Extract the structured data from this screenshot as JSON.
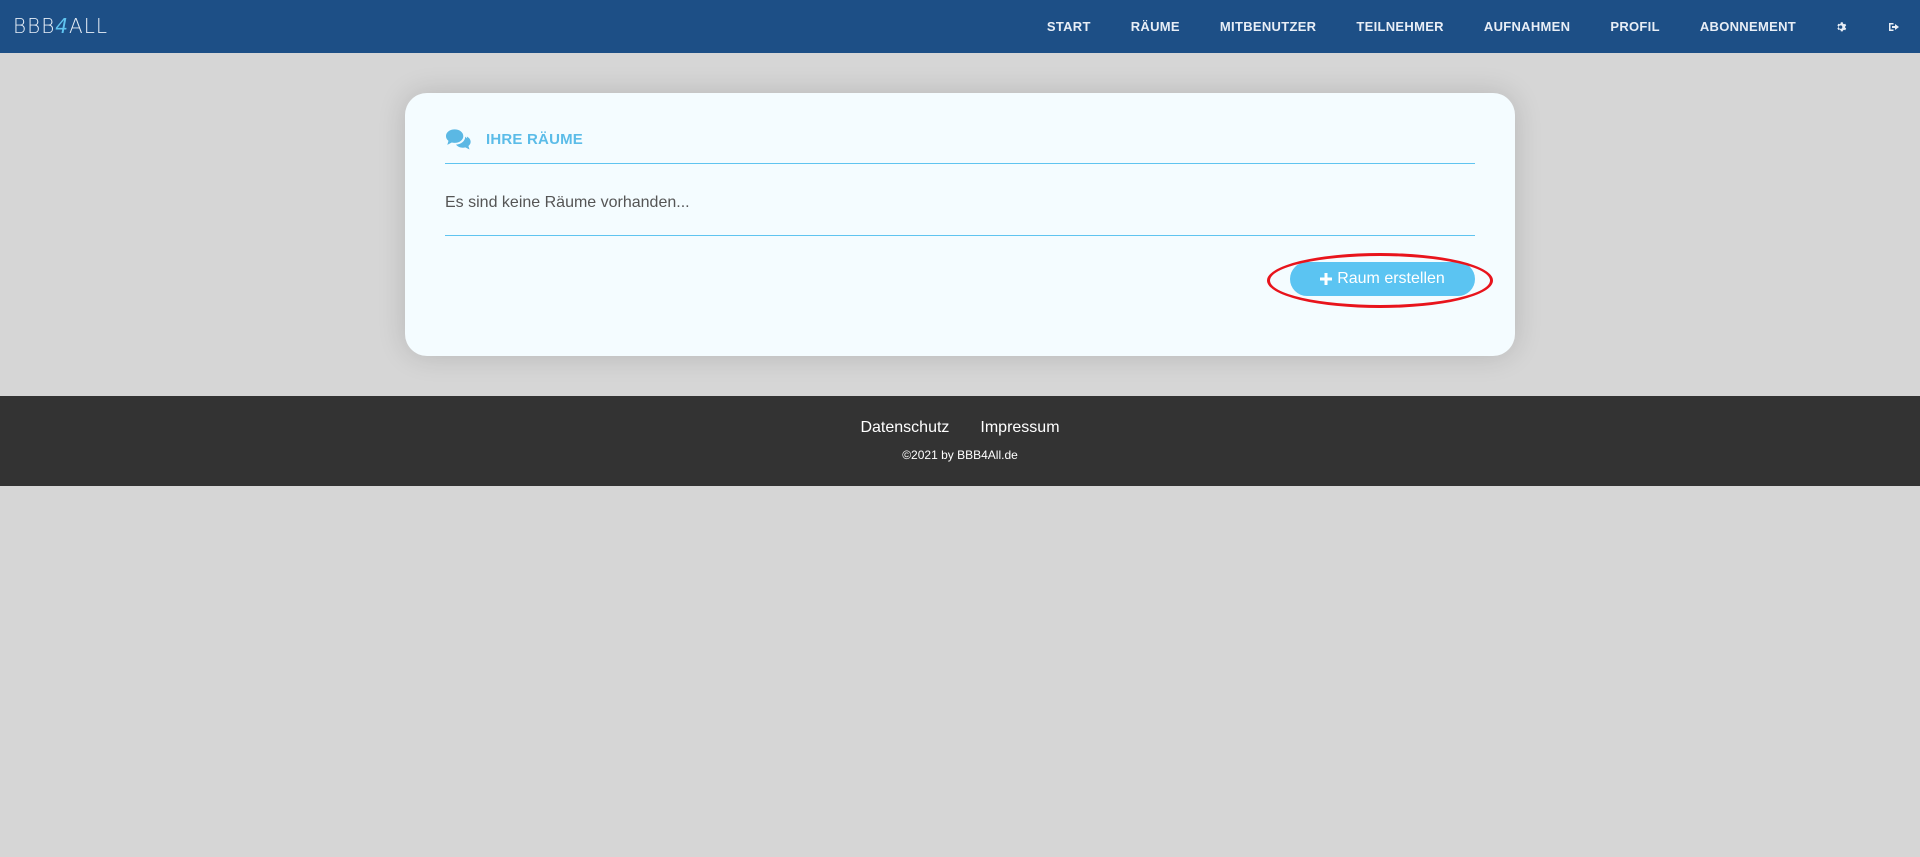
{
  "app": {
    "logo_main": "BBB",
    "logo_four": "4",
    "logo_tail": "ALL"
  },
  "nav": {
    "items": [
      "START",
      "RÄUME",
      "MITBENUTZER",
      "TEILNEHMER",
      "AUFNAHMEN",
      "PROFIL",
      "ABONNEMENT"
    ],
    "icons": [
      "gear-icon",
      "logout-icon"
    ]
  },
  "card": {
    "title": "IHRE RÄUME",
    "title_icon": "comments-icon",
    "empty_message": "Es sind keine Räume vorhanden...",
    "create_button_label": "Raum erstellen",
    "create_button_icon": "plus-icon"
  },
  "footer": {
    "links": [
      "Datenschutz",
      "Impressum"
    ],
    "copyright": "©2021 by BBB4All.de"
  },
  "colors": {
    "navbar": "#1d4f86",
    "accent": "#5bc4f2",
    "card_bg": "#f4fcff",
    "footer_bg": "#333333",
    "page_bg": "#d6d6d6",
    "highlight": "#e8141c"
  }
}
